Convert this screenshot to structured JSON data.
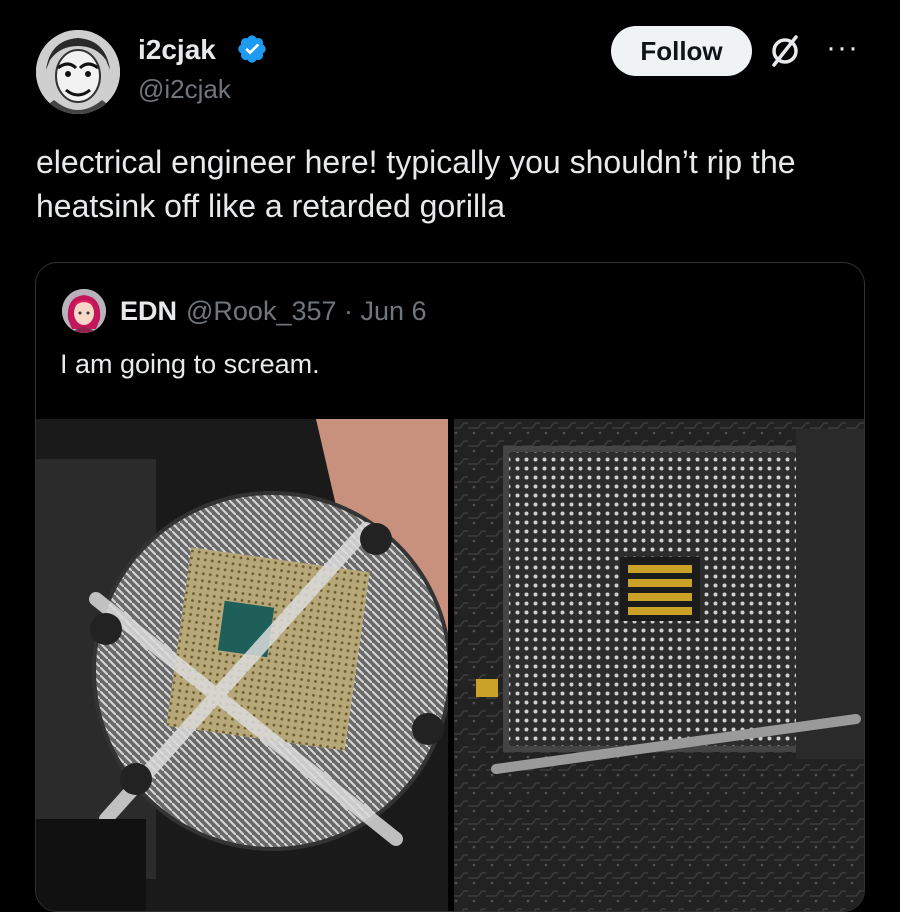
{
  "tweet": {
    "display_name": "i2cjak",
    "handle": "@i2cjak",
    "follow_label": "Follow",
    "more_label": "···",
    "text": "electrical engineer here! typically you shouldn’t rip the heatsink off like a retarded gorilla"
  },
  "quoted": {
    "display_name": "EDN",
    "handle_date": "@Rook_357 · Jun 6",
    "text": "I am going to scream."
  },
  "colors": {
    "background": "#000000",
    "text": "#e7e9ea",
    "muted": "#71767b",
    "verified": "#1d9bf0",
    "border": "#2f3336"
  },
  "icons": [
    "verified-badge-icon",
    "grok-icon",
    "more-options-icon"
  ]
}
